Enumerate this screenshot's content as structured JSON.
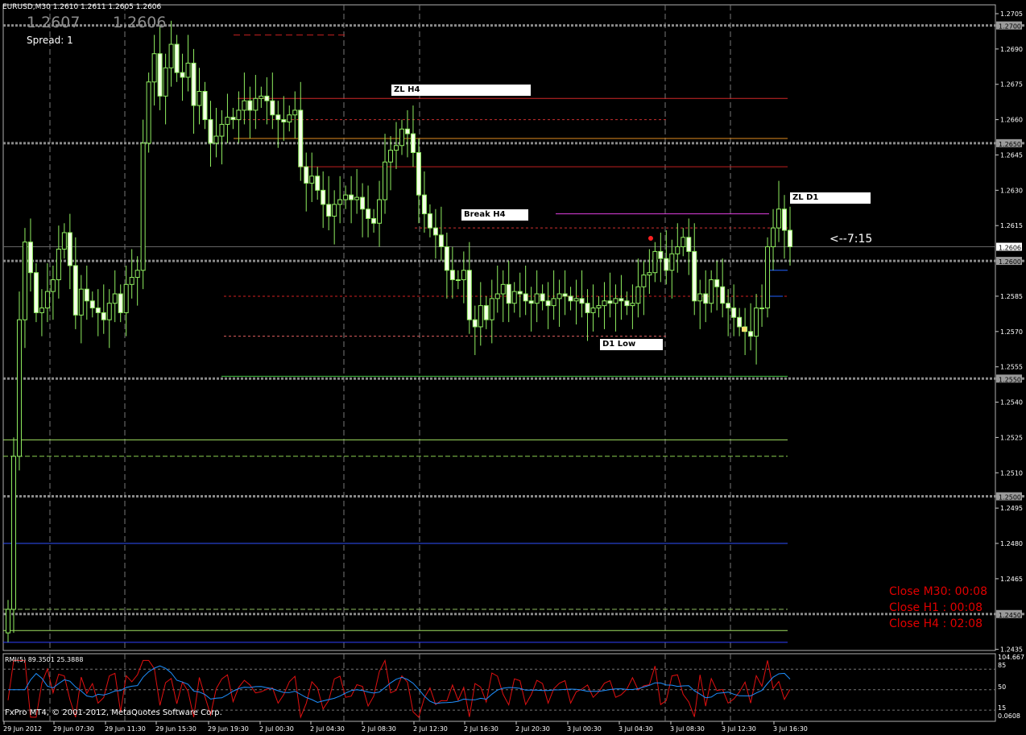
{
  "header": {
    "symbol_info": "EURUSD,M30  1.2610 1.2611 1.2605 1.2606",
    "bid_display": "1.2607",
    "ask_display": "1.2606",
    "spread_label": "Spread: 1"
  },
  "timer_label": "<--7:15",
  "close_labels": [
    "Close M30: 00:08",
    "Close H1 :  00:08",
    "Close H4 :  02:08"
  ],
  "labels": {
    "zl_h4": "ZL H4",
    "break_h4": "Break H4",
    "zl_d1": "ZL D1",
    "d1_low": "D1 Low"
  },
  "rmi": {
    "title": "RMI(5) 89.3501 25.3888",
    "scale": [
      "104.667",
      "85",
      "50",
      "15",
      "0.0608"
    ],
    "colors": {
      "main": "#e01010",
      "signal": "#1e90ff"
    }
  },
  "footer": {
    "copyright": "FxPro MT4, © 2001-2012, MetaQuotes Software Corp."
  },
  "chart_data": {
    "type": "candlestick",
    "symbol": "EURUSD",
    "timeframe": "M30",
    "ylim": [
      1.243,
      1.271
    ],
    "y_ticks": [
      "1.2705",
      "1.2690",
      "1.2675",
      "1.2660",
      "1.2645",
      "1.2630",
      "1.2615",
      "1.2585",
      "1.2570",
      "1.2555",
      "1.2540",
      "1.2525",
      "1.2510",
      "1.2495",
      "1.2480",
      "1.2465",
      "1.2435"
    ],
    "round_levels": [
      "1.2700",
      "1.2650",
      "1.2600",
      "1.2550",
      "1.2500",
      "1.2450"
    ],
    "current_price": "1.2606",
    "x_ticks": [
      "29 Jun 2012",
      "29 Jun 07:30",
      "29 Jun 11:30",
      "29 Jun 15:30",
      "29 Jun 19:30",
      "2 Jul 00:30",
      "2 Jul 04:30",
      "2 Jul 08:30",
      "2 Jul 12:30",
      "2 Jul 16:30",
      "2 Jul 20:30",
      "3 Jul 00:30",
      "3 Jul 04:30",
      "3 Jul 08:30",
      "3 Jul 12:30",
      "3 Jul 16:30"
    ],
    "closes": [
      1.2452,
      1.2517,
      1.2575,
      1.2608,
      1.2595,
      1.2578,
      1.258,
      1.2587,
      1.2592,
      1.2605,
      1.2612,
      1.2598,
      1.2577,
      1.2588,
      1.2583,
      1.258,
      1.2578,
      1.2575,
      1.2582,
      1.2586,
      1.2578,
      1.259,
      1.2593,
      1.2596,
      1.265,
      1.2676,
      1.2688,
      1.267,
      1.2682,
      1.2692,
      1.268,
      1.2678,
      1.2684,
      1.2666,
      1.2672,
      1.266,
      1.265,
      1.2653,
      1.2658,
      1.2661,
      1.266,
      1.2664,
      1.2668,
      1.2664,
      1.2669,
      1.267,
      1.2668,
      1.2662,
      1.266,
      1.2659,
      1.2662,
      1.2664,
      1.264,
      1.2633,
      1.2636,
      1.263,
      1.2624,
      1.2619,
      1.2624,
      1.2626,
      1.2628,
      1.2626,
      1.2627,
      1.2622,
      1.2618,
      1.2616,
      1.2626,
      1.2642,
      1.2647,
      1.2649,
      1.2656,
      1.2654,
      1.2646,
      1.2628,
      1.262,
      1.2614,
      1.2611,
      1.2606,
      1.2596,
      1.2592,
      1.2592,
      1.2596,
      1.2575,
      1.2572,
      1.2581,
      1.2575,
      1.2584,
      1.2586,
      1.259,
      1.2582,
      1.2587,
      1.2586,
      1.2583,
      1.2582,
      1.2586,
      1.2583,
      1.2581,
      1.2584,
      1.2586,
      1.2585,
      1.2583,
      1.2584,
      1.2582,
      1.2578,
      1.258,
      1.2581,
      1.2583,
      1.2582,
      1.2584,
      1.2583,
      1.2581,
      1.2582,
      1.2589,
      1.2594,
      1.2595,
      1.2604,
      1.2601,
      1.2596,
      1.2603,
      1.2606,
      1.261,
      1.2604,
      1.2583,
      1.2586,
      1.2582,
      1.2592,
      1.2589,
      1.2582,
      1.258,
      1.2576,
      1.2572,
      1.257,
      1.2568,
      1.258,
      1.258,
      1.2606,
      1.2614,
      1.2622,
      1.2613,
      1.2606
    ],
    "levels": [
      {
        "name": "ZL H4",
        "price": 1.2669
      },
      {
        "name": "Break H4",
        "price": 1.2614
      },
      {
        "name": "ZL D1",
        "price": 1.262
      },
      {
        "name": "D1 Low",
        "price": 1.2568
      }
    ]
  }
}
